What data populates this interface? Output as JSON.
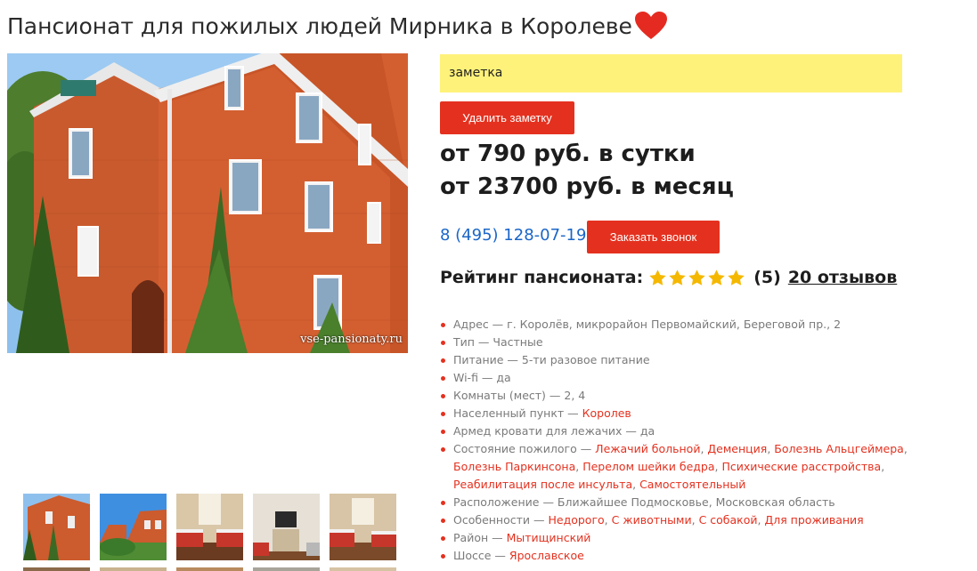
{
  "page": {
    "title": "Пансионат для пожилых людей Мирника в Королеве"
  },
  "photo": {
    "watermark": "vse-pansionaty.ru"
  },
  "note": {
    "text": "заметка",
    "delete_label": "Удалить заметку"
  },
  "prices": {
    "per_day": "от 790 руб. в сутки",
    "per_month": "от 23700 руб. в месяц"
  },
  "contact": {
    "phone": "8 (495) 128-07-19",
    "call_label": "Заказать звонок"
  },
  "rating": {
    "label": "Рейтинг пансионата:",
    "stars": 5,
    "count": "(5)",
    "reviews": "20 отзывов"
  },
  "details": {
    "address_label": "Адрес — ",
    "address_value": "г. Королёв, микрорайон Первомайский, Береговой пр., 2",
    "type_label": "Тип — ",
    "type_value": "Частные",
    "food_label": "Питание — ",
    "food_value": "5-ти разовое питание",
    "wifi_label": "Wi-fi — ",
    "wifi_value": "да",
    "rooms_label": "Комнаты (мест) — ",
    "rooms_value": "2, 4",
    "city_label": "Населенный пункт — ",
    "city_link": "Королев",
    "beds_label": "Армед кровати для лежачих — ",
    "beds_value": "да",
    "condition_label": "Состояние пожилого — ",
    "condition_links": [
      "Лежачий больной",
      "Деменция",
      "Болезнь Альцгеймера",
      "Болезнь Паркинсона",
      "Перелом шейки бедра",
      "Психические расстройства",
      "Реабилитация после инсульта",
      "Самостоятельный"
    ],
    "location_label": "Расположение — ",
    "location_value": "Ближайшее Подмосковье, Московская область",
    "features_label": "Особенности — ",
    "features_links": [
      "Недорого",
      "С животными",
      "С собакой",
      "Для проживания"
    ],
    "district_label": "Район — ",
    "district_link": "Мытищинский",
    "highway_label": "Шоссе — ",
    "highway_link": "Ярославское"
  },
  "colors": {
    "accent": "#e4311f",
    "note_bg": "#fff27a",
    "phone": "#1a66c8",
    "star": "#f5b800"
  }
}
